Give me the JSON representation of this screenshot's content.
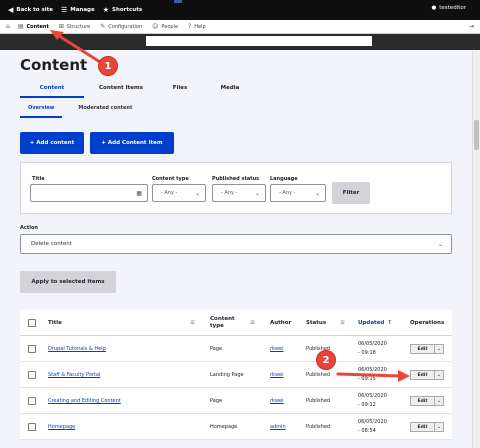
{
  "toolbar": {
    "back_label": "Back to site",
    "manage_label": "Manage",
    "shortcuts_label": "Shortcuts",
    "user_label": "testeditor"
  },
  "admin_menu": {
    "items": [
      {
        "label": "Content"
      },
      {
        "label": "Structure"
      },
      {
        "label": "Configuration"
      },
      {
        "label": "People"
      },
      {
        "label": "Help"
      }
    ]
  },
  "page": {
    "title": "Content",
    "tabs": [
      "Content",
      "Content Items",
      "Files",
      "Media"
    ],
    "subtabs": [
      "Overview",
      "Moderated content"
    ],
    "add_content_label": "+ Add content",
    "add_item_label": "+ Add Content Item"
  },
  "filters": {
    "title_label": "Title",
    "type_label": "Content type",
    "type_value": "- Any -",
    "status_label": "Published status",
    "status_value": "- Any -",
    "language_label": "Language",
    "language_value": "- Any -",
    "filter_button": "Filter"
  },
  "action": {
    "label": "Action",
    "value": "Delete content",
    "apply_button": "Apply to selected items"
  },
  "table": {
    "headers": {
      "title": "Title",
      "type": "Content type",
      "author": "Author",
      "status": "Status",
      "updated": "Updated",
      "operations": "Operations"
    },
    "rows": [
      {
        "title": "Drupal Tutorials & Help",
        "type": "Page",
        "author": "rkwei",
        "status": "Published",
        "updated_date": "06/05/2020",
        "updated_time": "- 09:18",
        "op": "Edit"
      },
      {
        "title": "Staff & Faculty Portal",
        "type": "Landing Page",
        "author": "rkwei",
        "status": "Published",
        "updated_date": "06/05/2020",
        "updated_time": "- 09:15",
        "op": "Edit"
      },
      {
        "title": "Creating and Editing Content",
        "type": "Page",
        "author": "rkwei",
        "status": "Published",
        "updated_date": "06/05/2020",
        "updated_time": "- 09:12",
        "op": "Edit"
      },
      {
        "title": "Homepage",
        "type": "Homepage",
        "author": "admin",
        "status": "Published",
        "updated_date": "06/05/2020",
        "updated_time": "- 08:54",
        "op": "Edit"
      }
    ]
  },
  "annotations": {
    "one": "1",
    "two": "2",
    "color": "#e8463a"
  }
}
